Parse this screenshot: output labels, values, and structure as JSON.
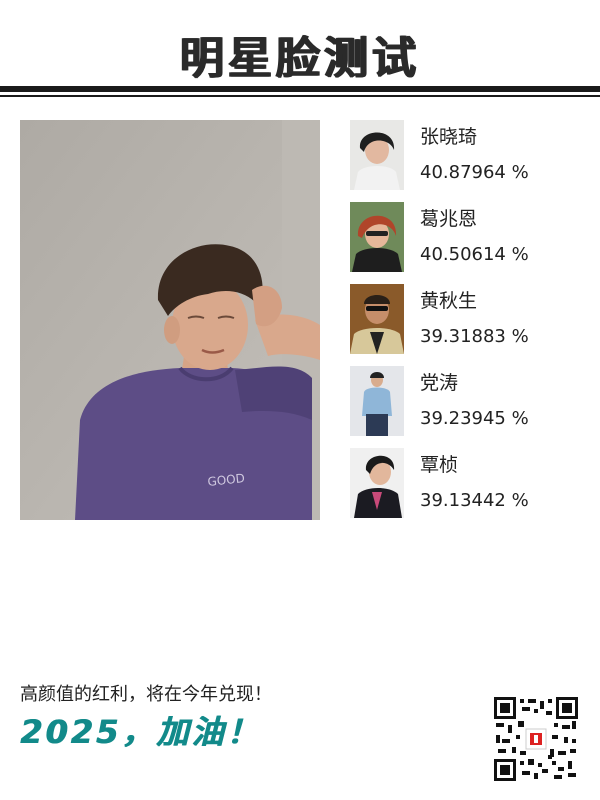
{
  "header": {
    "title": "明星脸测试"
  },
  "matches": [
    {
      "name": "张晓琦",
      "score": "40.87964 %"
    },
    {
      "name": "葛兆恩",
      "score": "40.50614 %"
    },
    {
      "name": "黄秋生",
      "score": "39.31883 %"
    },
    {
      "name": "党涛",
      "score": "39.23945 %"
    },
    {
      "name": "覃桢",
      "score": "39.13442 %"
    }
  ],
  "footer": {
    "slogan": "高颜值的红利，将在今年兑现！",
    "cheer": "2025，加油！"
  },
  "colors": {
    "accent": "#128a8a",
    "rule": "#1a1a1a"
  }
}
